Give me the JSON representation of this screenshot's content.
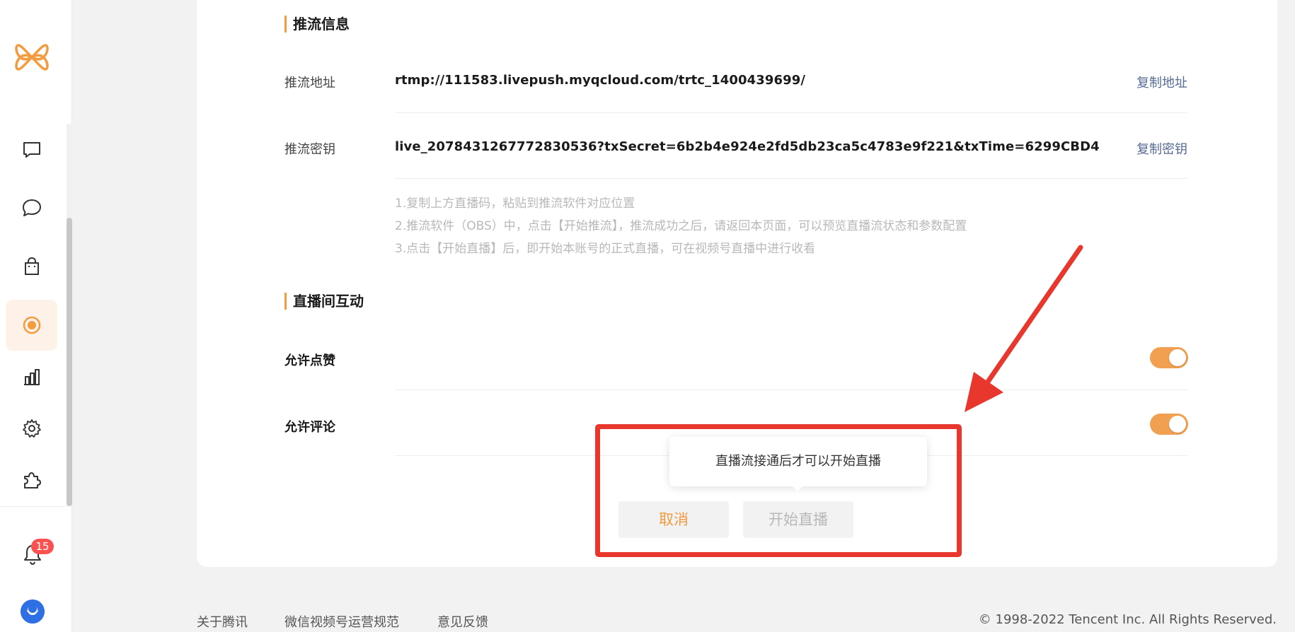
{
  "sidebar": {
    "logo_icon": "wechat-channels-logo-icon",
    "items": [
      {
        "name": "comment",
        "icon": "comment-square-icon"
      },
      {
        "name": "message",
        "icon": "chat-bubble-icon"
      },
      {
        "name": "shop",
        "icon": "shopping-bag-icon"
      },
      {
        "name": "live",
        "icon": "live-record-icon",
        "active": true
      },
      {
        "name": "data",
        "icon": "bar-chart-icon"
      },
      {
        "name": "settings",
        "icon": "gear-icon"
      },
      {
        "name": "plugins",
        "icon": "puzzle-icon"
      }
    ],
    "notifications_count": "15"
  },
  "stream_info": {
    "title": "推流信息",
    "address_label": "推流地址",
    "address_value": "rtmp://111583.livepush.myqcloud.com/trtc_1400439699/",
    "copy_address": "复制地址",
    "key_label": "推流密钥",
    "key_value": "live_207843126777283053​6?txSecret=6b2b4e924e2fd5db23ca5c4783e9f221&txTime=6299CBD4",
    "copy_key": "复制密钥",
    "tips": [
      "1.复制上方直播码，粘贴到推流软件对应位置",
      "2.推流软件（OBS）中，点击【开始推流】，推流成功之后，请返回本页面，可以预览直播流状态和参数配置",
      "3.点击【开始直播】后，即开始本账号的正式直播，可在视频号直播中进行收看"
    ]
  },
  "interaction": {
    "title": "直播间互动",
    "allow_like_label": "允许点赞",
    "allow_like": true,
    "allow_comment_label": "允许评论",
    "allow_comment": true
  },
  "dialog": {
    "tooltip": "直播流接通后才可以开始直播",
    "cancel_label": "取消",
    "start_label": "开始直播"
  },
  "footer": {
    "links": [
      "关于腾讯",
      "微信视频号运营规范",
      "意见反馈"
    ],
    "copyright": "© 1998-2022 Tencent Inc. All Rights Reserved."
  },
  "annotation": {
    "highlight_color": "#e8372c"
  },
  "colors": {
    "accent": "#f29b3f",
    "link": "#576b95"
  }
}
